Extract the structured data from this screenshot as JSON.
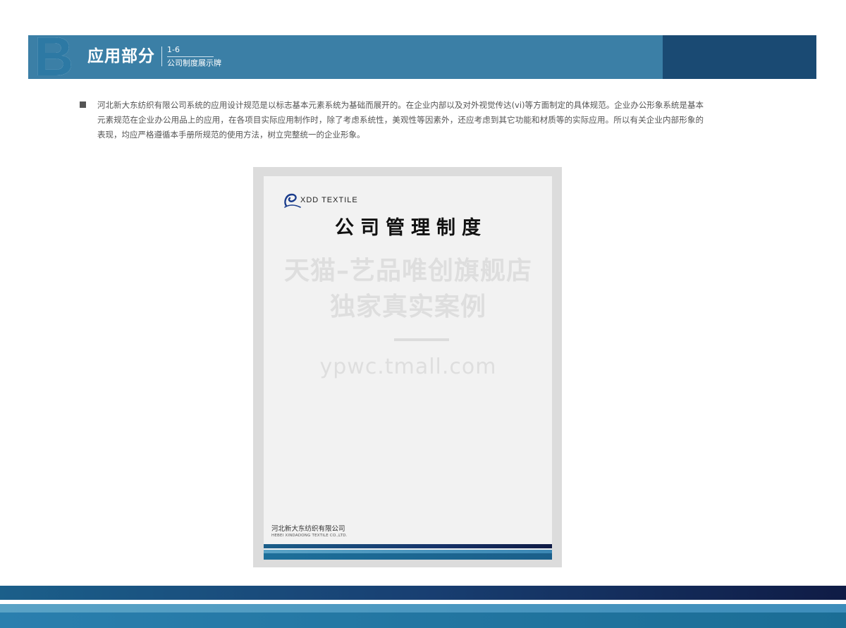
{
  "header": {
    "letter": "B",
    "title": "应用部分",
    "number": "1-6",
    "subtitle": "公司制度展示牌"
  },
  "intro": {
    "text": "河北新大东纺织有限公司系统的应用设计规范是以标志基本元素系统为基础而展开的。在企业内部以及对外视觉传达(vi)等方面制定的具体规范。企业办公形象系统是基本元素规范在企业办公用品上的应用，在各项目实际应用制作时，除了考虑系统性，美观性等因素外，还应考虑到其它功能和材质等的实际应用。所以有关企业内部形象的表现，均应严格遵循本手册所规范的使用方法，树立完整统一的企业形象。"
  },
  "board": {
    "logo_text": "XDD TEXTILE",
    "title": "公司管理制度",
    "watermark_line1": "天猫–艺品唯创旗舰店",
    "watermark_line2": "独家真实案例",
    "watermark_url": "ypwc.tmall.com",
    "company_cn": "河北新大东纺织有限公司",
    "company_en": "HEBEI XINDADONG TEXTILE CO.,LTD."
  },
  "colors": {
    "brand_blue": "#3b7fa6",
    "brand_dark": "#1a4a73",
    "navy": "#0f1b45",
    "teal": "#1b6d95",
    "light_blue": "#5aa3c6"
  }
}
